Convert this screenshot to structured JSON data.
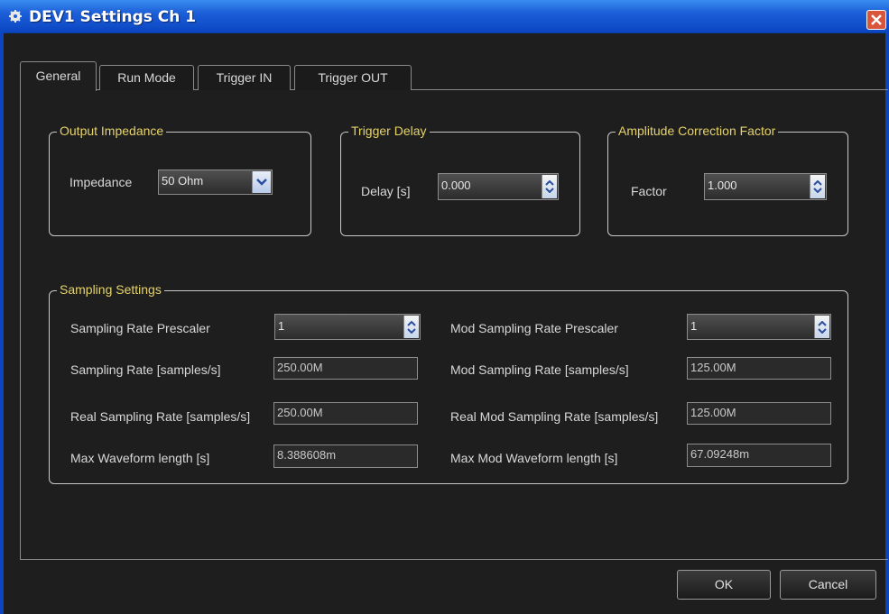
{
  "window": {
    "title": "DEV1 Settings Ch 1"
  },
  "tabs": [
    {
      "label": "General",
      "active": true
    },
    {
      "label": "Run Mode",
      "active": false
    },
    {
      "label": "Trigger IN",
      "active": false
    },
    {
      "label": "Trigger OUT",
      "active": false
    }
  ],
  "output_impedance": {
    "title": "Output Impedance",
    "label": "Impedance",
    "value": "50 Ohm"
  },
  "trigger_delay": {
    "title": "Trigger Delay",
    "label": "Delay [s]",
    "value": "0.000"
  },
  "amplitude": {
    "title": "Amplitude Correction Factor",
    "label": "Factor",
    "value": "1.000"
  },
  "sampling": {
    "title": "Sampling Settings",
    "left": [
      {
        "label": "Sampling Rate Prescaler",
        "value": "1"
      },
      {
        "label": "Sampling Rate [samples/s]",
        "value": "250.00M"
      },
      {
        "label": "Real Sampling Rate [samples/s]",
        "value": "250.00M"
      },
      {
        "label": "Max Waveform length [s]",
        "value": "8.388608m"
      }
    ],
    "right": [
      {
        "label": "Mod Sampling Rate Prescaler",
        "value": "1"
      },
      {
        "label": "Mod Sampling Rate [samples/s]",
        "value": "125.00M"
      },
      {
        "label": "Real Mod Sampling Rate [samples/s]",
        "value": "125.00M"
      },
      {
        "label": "Max Mod Waveform length [s]",
        "value": "67.09248m"
      }
    ]
  },
  "buttons": {
    "ok": "OK",
    "cancel": "Cancel"
  },
  "colors": {
    "titlebar": "#1c5fd8",
    "group_title": "#e6d36a",
    "background": "#1e1e1e",
    "close": "#d9553b"
  },
  "icons": {
    "title": "gear-icon",
    "close": "close-icon",
    "spin": "spin-arrows-icon",
    "dropdown": "chevron-down-icon"
  }
}
